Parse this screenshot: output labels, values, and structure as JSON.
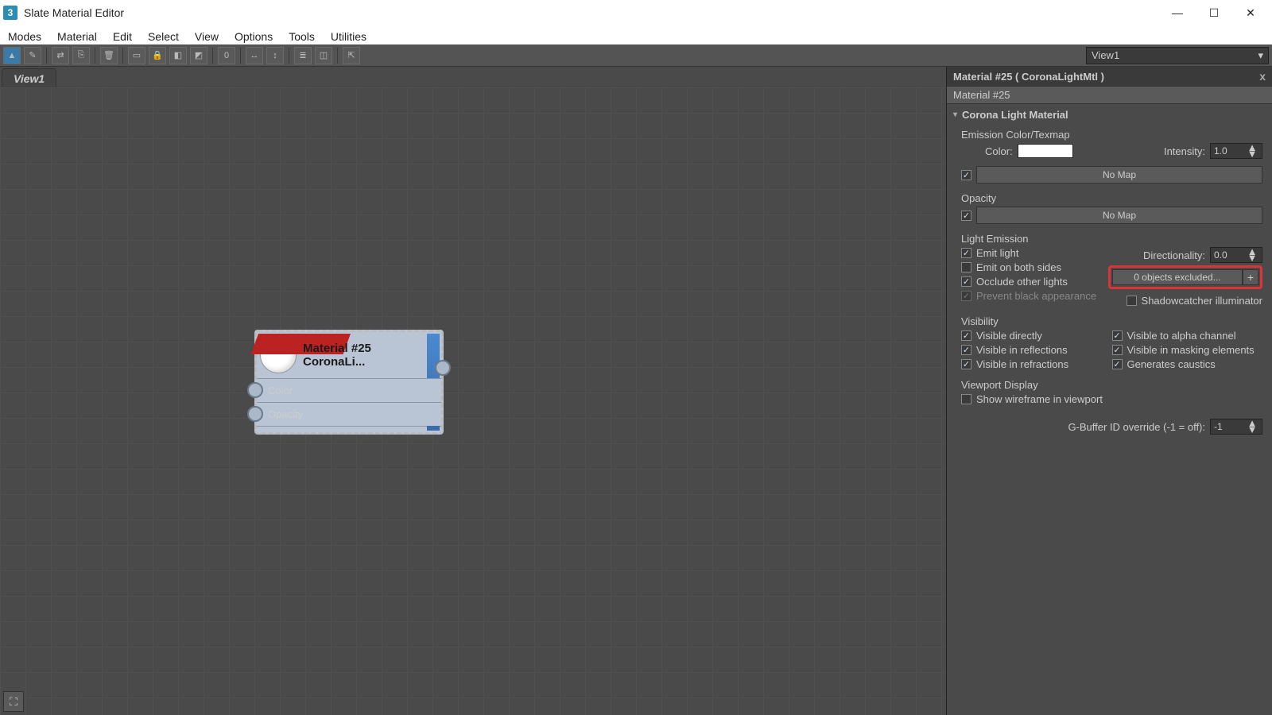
{
  "app": {
    "icon": "3",
    "title": "Slate Material Editor"
  },
  "menu": [
    "Modes",
    "Material",
    "Edit",
    "Select",
    "View",
    "Options",
    "Tools",
    "Utilities"
  ],
  "toolbar": {
    "btns": [
      "▲",
      "✎",
      "⇄",
      "⎘",
      "🗑",
      "▭",
      "🔒",
      "◧",
      "◩",
      "0",
      "↔",
      "↕",
      "≣",
      "◫",
      "⇱"
    ],
    "dropdown": "View1"
  },
  "view": {
    "tab": "View1"
  },
  "node": {
    "title": "Material #25",
    "subtitle": "CoronaLi...",
    "inputs": [
      "Color",
      "Opacity"
    ]
  },
  "panel": {
    "header": "Material #25  ( CoronaLightMtl )",
    "sub": "Material #25",
    "rollup": "Corona Light Material",
    "emission": {
      "group": "Emission Color/Texmap",
      "color_label": "Color:",
      "intensity_label": "Intensity:",
      "intensity_value": "1.0",
      "map_label": "No Map"
    },
    "opacity": {
      "group": "Opacity",
      "map_label": "No Map"
    },
    "light_emission": {
      "group": "Light Emission",
      "emit_light": "Emit light",
      "emit_both": "Emit on both sides",
      "occlude": "Occlude other lights",
      "prevent": "Prevent black appearance",
      "directionality_label": "Directionality:",
      "directionality_value": "0.0",
      "excluded": "0 objects excluded...",
      "shadowcatcher": "Shadowcatcher illuminator"
    },
    "visibility": {
      "group": "Visibility",
      "v1": "Visible directly",
      "v2": "Visible in reflections",
      "v3": "Visible in refractions",
      "v4": "Visible to alpha channel",
      "v5": "Visible in masking elements",
      "v6": "Generates caustics"
    },
    "viewport": {
      "group": "Viewport Display",
      "wire": "Show wireframe in viewport"
    },
    "gbuffer": {
      "label": "G-Buffer ID override (-1 = off):",
      "value": "-1"
    }
  }
}
